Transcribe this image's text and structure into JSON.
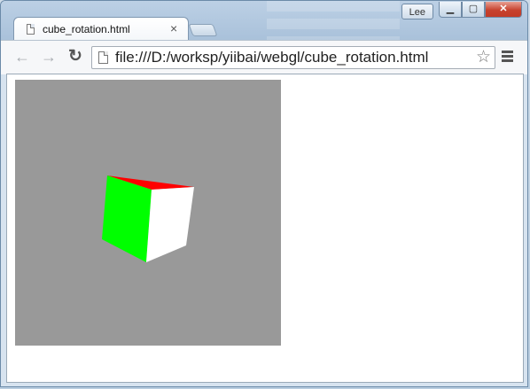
{
  "tab": {
    "title": "cube_rotation.html",
    "close_glyph": "×"
  },
  "window": {
    "user": "Lee",
    "minimize_glyph": "▁",
    "maximize_glyph": "▢",
    "close_glyph": "✕"
  },
  "toolbar": {
    "back_glyph": "←",
    "forward_glyph": "→",
    "reload_glyph": "↻",
    "url": "file:///D:/worksp/yiibai/webgl/cube_rotation.html",
    "star_glyph": "☆"
  },
  "icons": {
    "back": "arrow-left-icon",
    "forward": "arrow-right-icon",
    "reload": "reload-icon",
    "page": "page-icon",
    "star": "star-icon",
    "menu": "hamburger-menu-icon"
  },
  "canvas": {
    "background": "#999999",
    "face_colors": {
      "top": "#ff0000",
      "left": "#00ff00",
      "front": "#ffffff"
    }
  }
}
